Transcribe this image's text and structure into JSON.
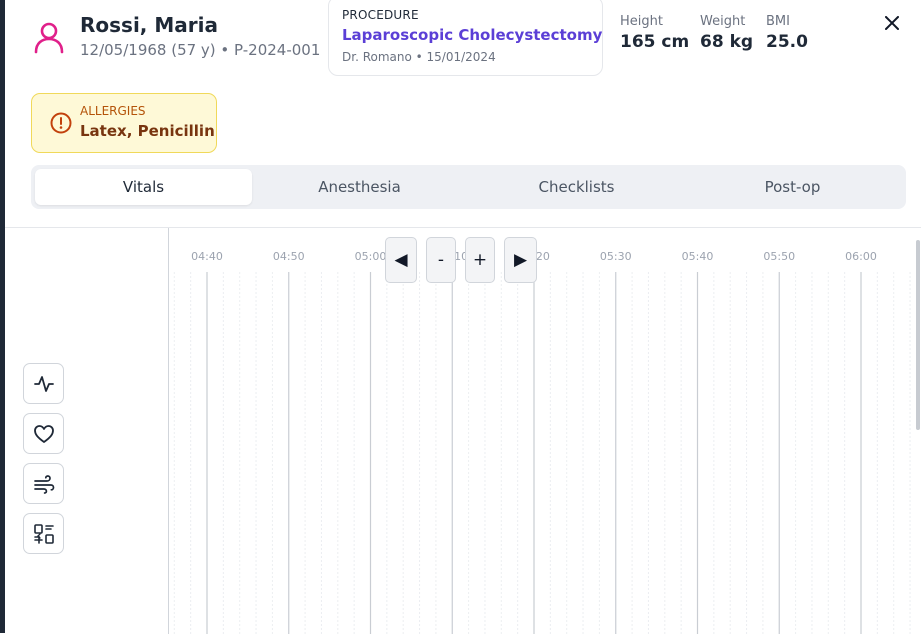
{
  "patient": {
    "name": "Rossi, Maria",
    "subtitle": "12/05/1968 (57 y) • P-2024-001"
  },
  "procedure": {
    "label": "PROCEDURE",
    "title": "Laparoscopic Cholecystectomy",
    "subtitle": "Dr. Romano • 15/01/2024"
  },
  "metrics": [
    {
      "label": "Height",
      "value": "165 cm"
    },
    {
      "label": "Weight",
      "value": "68 kg"
    },
    {
      "label": "BMI",
      "value": "25.0"
    }
  ],
  "allergies": {
    "label": "ALLERGIES",
    "value": "Latex, Penicillin"
  },
  "tabs": [
    "Vitals",
    "Anesthesia",
    "Checklists",
    "Post-op"
  ],
  "active_tab": "Vitals",
  "timeline": {
    "ticks": [
      "04:40",
      "04:50",
      "05:00",
      "05:10",
      "05:20",
      "05:30",
      "05:40",
      "05:50",
      "06:00"
    ],
    "controls": {
      "prev": "◀",
      "zoom_out": "-",
      "zoom_in": "+",
      "next": "▶"
    }
  },
  "side_tools": [
    "activity-icon",
    "heart-icon",
    "wind-icon",
    "layout-switch-icon"
  ],
  "colors": {
    "accent": "#5b3fd6",
    "patient_icon": "#e0208a",
    "allergy_bg": "#fef9d7",
    "allergy_border": "#f0d95a",
    "allergy_text": "#78350f"
  }
}
